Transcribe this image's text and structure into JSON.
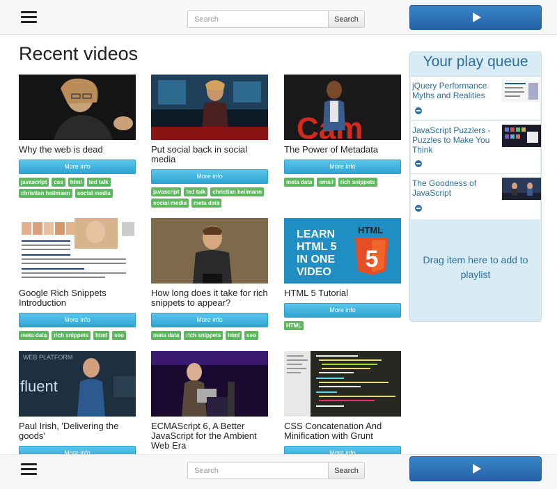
{
  "nav": {
    "menu_icon": "hamburger-menu-icon",
    "search_placeholder": "Search",
    "search_button": "Search",
    "play_icon": "play-icon"
  },
  "page_title": "Recent videos",
  "more_info_label": "More info",
  "videos": [
    {
      "title": "Why the web is dead",
      "tags": [
        "javascript",
        "css",
        "html",
        "ted talk",
        "christian heilmann",
        "social media"
      ]
    },
    {
      "title": "Put social back in social media",
      "tags": [
        "javascript",
        "ted talk",
        "christian heilmann",
        "social media",
        "meta data"
      ]
    },
    {
      "title": "The Power of Metadata",
      "tags": [
        "meta data",
        "email",
        "rich snippets"
      ]
    },
    {
      "title": "Google Rich Snippets Introduction",
      "tags": [
        "meta data",
        "rich snippets",
        "html",
        "seo"
      ]
    },
    {
      "title": "How long does it take for rich snippets to appear?",
      "tags": [
        "meta data",
        "rich snippets",
        "html",
        "seo"
      ]
    },
    {
      "title": "HTML 5 Tutorial",
      "tags": [
        "HTML"
      ]
    },
    {
      "title": "Paul Irish, 'Delivering the goods'",
      "tags": []
    },
    {
      "title": "ECMAScript 6, A Better JavaScript for the Ambient Web Era",
      "tags": []
    },
    {
      "title": "CSS Concatenation And Minification with Grunt",
      "tags": []
    }
  ],
  "thumb_text": {
    "html5_lines": [
      "LEARN",
      "HTML 5",
      "IN ONE",
      "VIDEO"
    ],
    "html5_badge": "HTML",
    "fluent": "fluent",
    "web_platform": "WEB PLATFORM",
    "tedx": "Cam"
  },
  "queue": {
    "title": "Your play queue",
    "items": [
      {
        "title": "jQuery Performance Myths and Realities"
      },
      {
        "title": "JavaScript Puzzlers - Puzzles to Make You Think"
      },
      {
        "title": "The Goodness of JavaScript"
      }
    ],
    "drop_text": "Drag item here to add to playlist"
  }
}
